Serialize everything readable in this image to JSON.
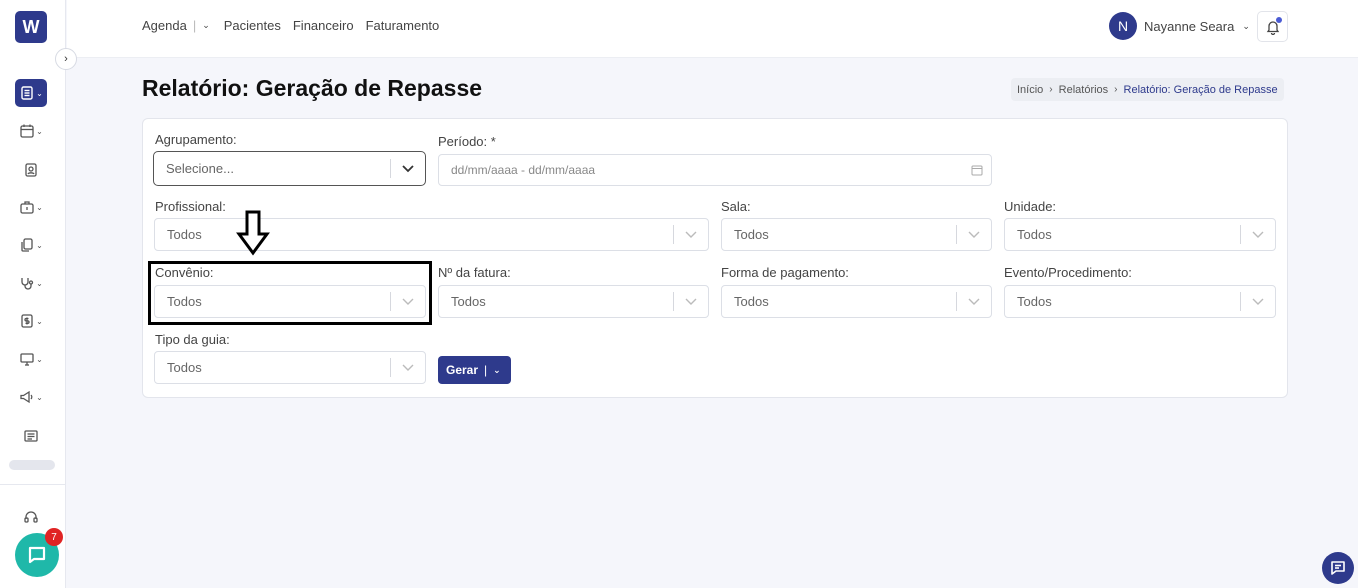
{
  "app": {
    "logo_letter": "W"
  },
  "nav": {
    "items": [
      "Agenda",
      "Pacientes",
      "Financeiro",
      "Faturamento"
    ]
  },
  "user": {
    "initial": "N",
    "name": "Nayanne Seara"
  },
  "page": {
    "title": "Relatório: Geração de Repasse"
  },
  "breadcrumb": {
    "items": [
      "Início",
      "Relatórios",
      "Relatório: Geração de Repasse"
    ]
  },
  "form": {
    "agrupamento": {
      "label": "Agrupamento:",
      "value": "Selecione..."
    },
    "periodo": {
      "label": "Período: *",
      "placeholder": "dd/mm/aaaa - dd/mm/aaaa"
    },
    "profissional": {
      "label": "Profissional:",
      "value": "Todos"
    },
    "sala": {
      "label": "Sala:",
      "value": "Todos"
    },
    "unidade": {
      "label": "Unidade:",
      "value": "Todos"
    },
    "convenio": {
      "label": "Convênio:",
      "value": "Todos"
    },
    "fatura": {
      "label": "Nº da fatura:",
      "value": "Todos"
    },
    "pagamento": {
      "label": "Forma de pagamento:",
      "value": "Todos"
    },
    "evento": {
      "label": "Evento/Procedimento:",
      "value": "Todos"
    },
    "guia": {
      "label": "Tipo da guia:",
      "value": "Todos"
    },
    "gerar_label": "Gerar"
  },
  "chat": {
    "badge_count": "7"
  },
  "colors": {
    "primary": "#2e3a8c",
    "chat": "#1fb8a9",
    "badge": "#e02424"
  }
}
